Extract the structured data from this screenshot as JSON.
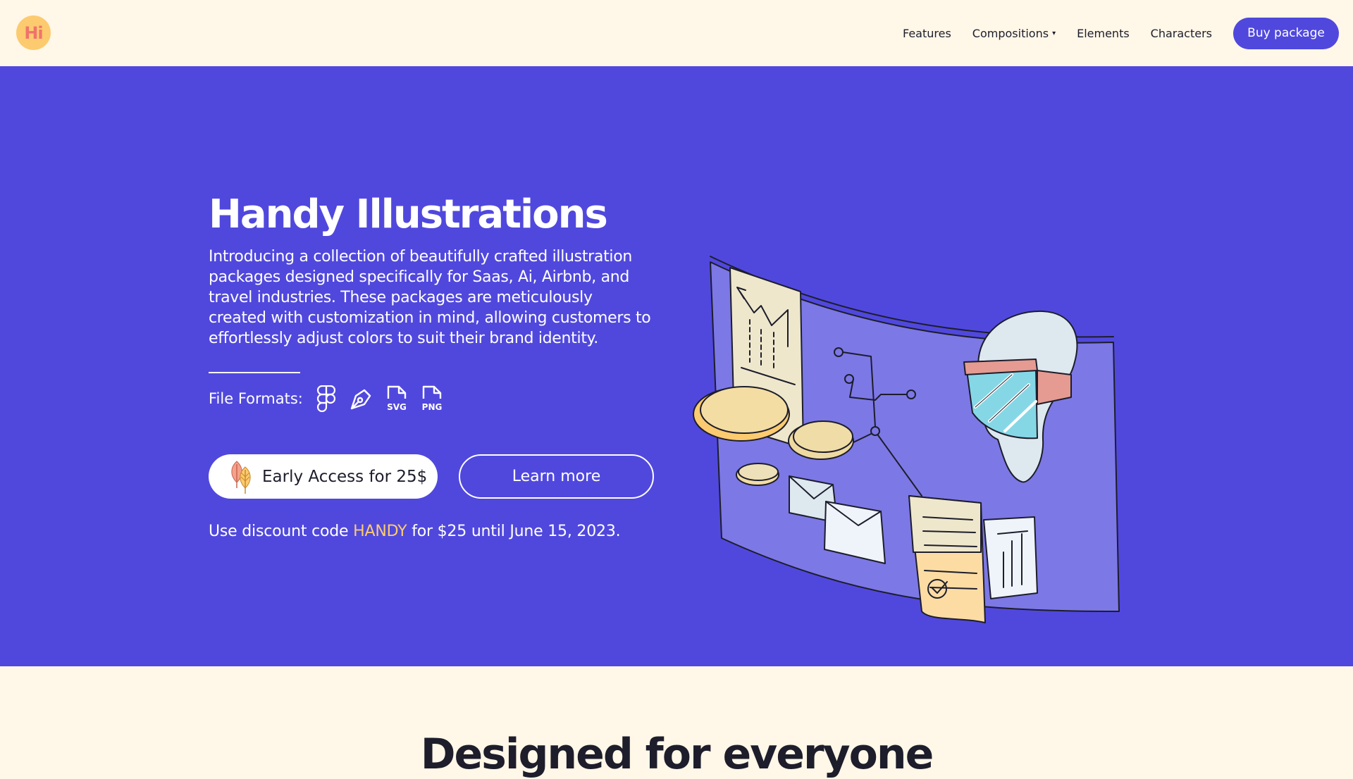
{
  "header": {
    "logo_text": "Hi",
    "nav": [
      "Features",
      "Compositions",
      "Elements",
      "Characters"
    ],
    "compositions_caret": "▾",
    "buy_label": "Buy package"
  },
  "hero": {
    "title": "Handy Illustrations",
    "description": "Introducing a collection of beautifully crafted illustration packages designed specifically for Saas, Ai, Airbnb, and travel industries. These packages are meticulously created with customization in mind, allowing customers to effortlessly adjust colors to suit their brand identity.",
    "formats_label": "File Formats:",
    "formats": [
      {
        "icon": "figma-icon"
      },
      {
        "icon": "pen-tool-icon"
      },
      {
        "icon": "svg-file-icon",
        "label": "SVG"
      },
      {
        "icon": "png-file-icon",
        "label": "PNG"
      }
    ],
    "early_access_label": "Early Access for 25$",
    "learn_more_label": "Learn more",
    "discount_prefix": "Use discount code",
    "discount_code": "HANDY",
    "discount_suffix": "for $25 until June 15, 2023."
  },
  "next_section": {
    "title": "Designed for everyone"
  },
  "colors": {
    "brand": "#5048dd",
    "background": "#fff7e8",
    "accent": "#fccb6f",
    "logo_text": "#f0736c"
  }
}
